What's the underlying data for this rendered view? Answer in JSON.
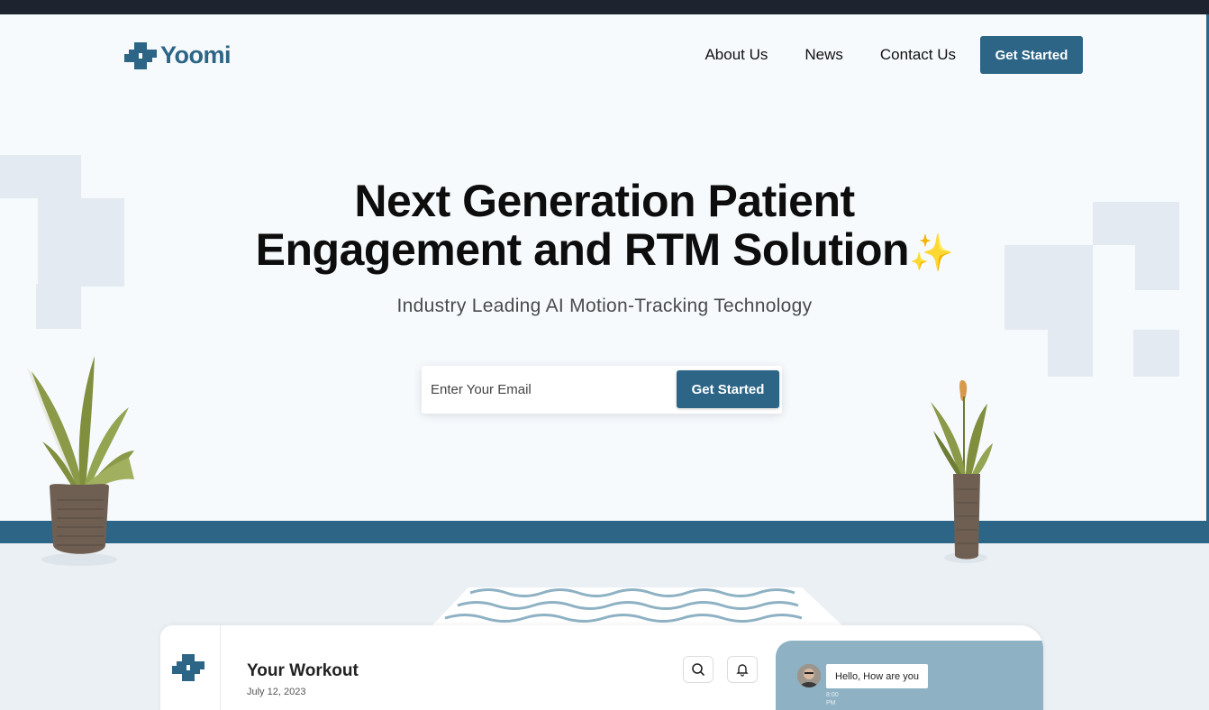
{
  "header": {
    "brand": "Yoomi",
    "nav": [
      {
        "label": "About Us"
      },
      {
        "label": "News"
      },
      {
        "label": "Contact Us"
      }
    ],
    "cta_label": "Get Started"
  },
  "hero": {
    "title_bold": "Next Generation",
    "title_rest_1": " Patient",
    "title_line_2": "Engagement and RTM Solution",
    "sparkle": "✨",
    "subtitle": "Industry Leading AI Motion-Tracking Technology",
    "email_placeholder": "Enter Your Email",
    "email_button": "Get Started"
  },
  "dashboard": {
    "title": "Your Workout",
    "date": "July 12, 2023",
    "chat_message": "Hello, How are you",
    "chat_time": "8:00 PM"
  },
  "colors": {
    "brand": "#2d6586",
    "background": "#f6fafd",
    "floor": "#ebf0f4",
    "chat_panel": "#8eb1c3"
  }
}
